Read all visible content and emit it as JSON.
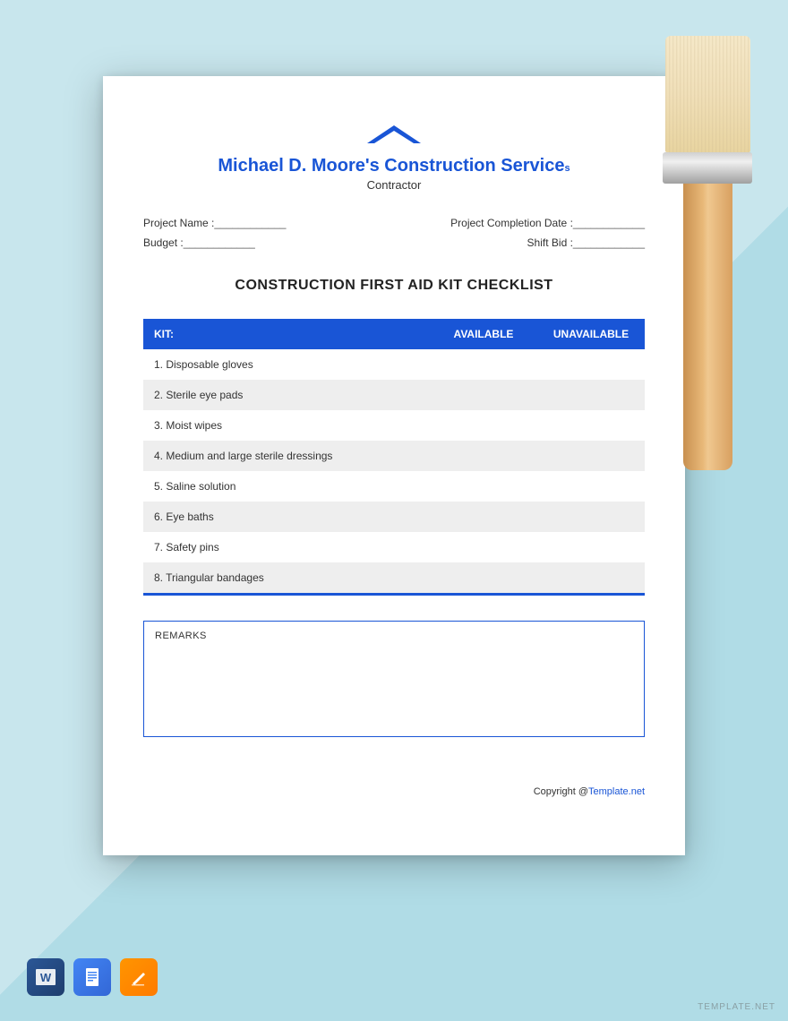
{
  "header": {
    "company_name": "Michael D. Moore's Construction Service",
    "company_suffix": "s",
    "subtitle": "Contractor"
  },
  "form": {
    "project_name_label": "Project Name :",
    "budget_label": "Budget :",
    "completion_label": "Project Completion Date :",
    "shift_bid_label": "Shift Bid :",
    "blank": " ____________"
  },
  "title": "CONSTRUCTION FIRST AID KIT CHECKLIST",
  "table": {
    "col_kit": "KIT:",
    "col_available": "AVAILABLE",
    "col_unavailable": "UNAVAILABLE",
    "rows": [
      "1. Disposable gloves",
      "2. Sterile eye pads",
      "3. Moist wipes",
      "4. Medium and large sterile dressings",
      "5. Saline solution",
      "6. Eye baths",
      "7. Safety pins",
      "8. Triangular bandages"
    ]
  },
  "remarks": {
    "label": "REMARKS"
  },
  "footer": {
    "copyright_prefix": "Copyright @",
    "copyright_link": "Template.net"
  },
  "watermark": "TEMPLATE.NET"
}
